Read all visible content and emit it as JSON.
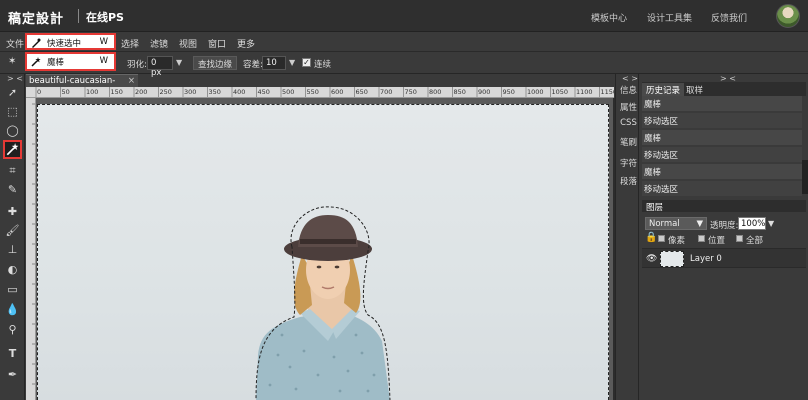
{
  "header": {
    "logo": "稿定設計",
    "subtitle": "在线PS",
    "links": [
      "模板中心",
      "设计工具集",
      "反馈我们"
    ]
  },
  "menu": {
    "items": [
      "文件",
      "选择",
      "滤镜",
      "视图",
      "窗口",
      "更多"
    ]
  },
  "tool_popups": {
    "quick_select": {
      "label": "快速选中",
      "key": "W"
    },
    "magic_wand": {
      "label": "魔棒",
      "key": "W"
    }
  },
  "options": {
    "feather_label": "羽化:",
    "feather_value": "0  px",
    "find_edge_label": "查找边缘",
    "tolerance_label": "容差:",
    "tolerance_value": "10",
    "contiguous_label": "连续",
    "contiguous_checked": true
  },
  "toolbox": {
    "collapse": "> <",
    "tools": [
      "move-icon",
      "marquee-icon",
      "lasso-icon",
      "magic-wand-icon",
      "crop-icon",
      "eyedropper-icon",
      "healing-icon",
      "brush-icon",
      "clone-stamp-icon",
      "eraser-icon",
      "gradient-icon",
      "blur-icon",
      "dodge-icon",
      "text-icon",
      "pen-icon"
    ],
    "active": "magic-wand-icon"
  },
  "document": {
    "tab_title": "beautiful-caucasian-",
    "close": "×",
    "ruler_marks": [
      "0",
      "50",
      "100",
      "150",
      "200",
      "250",
      "300",
      "350",
      "400",
      "450",
      "500",
      "550",
      "600",
      "650",
      "700",
      "750",
      "800",
      "850",
      "900",
      "950",
      "1000",
      "1050",
      "1100",
      "1150"
    ]
  },
  "side_panel": {
    "collapse": "< >",
    "tabs": [
      "信息",
      "属性",
      "CSS",
      "笔刷",
      "字符",
      "段落"
    ]
  },
  "right_panel": {
    "collapse": "> <",
    "history_tabs": [
      "历史记录",
      "取样"
    ],
    "history": [
      "魔棒",
      "移动选区",
      "魔棒",
      "移动选区",
      "魔棒",
      "移动选区"
    ],
    "layers_title": "图层",
    "blend_mode": "Normal",
    "opacity_label": "透明度:",
    "opacity_value": "100%",
    "lock_labels": [
      "像素",
      "位置",
      "全部"
    ],
    "layer_name": "Layer 0"
  },
  "colors": {
    "accent_red": "#e53935",
    "bg_dark": "#3a3a3a",
    "photo_bg": "#e2e6e8",
    "shirt": "#9ab8c4",
    "hat": "#5a4a48"
  }
}
